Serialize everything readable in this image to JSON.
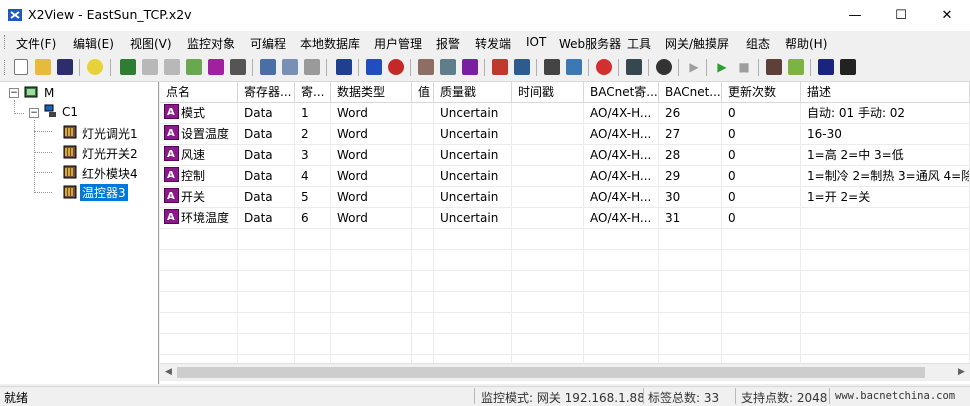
{
  "window": {
    "title": "X2View - EastSun_TCP.x2v",
    "minimize": "—",
    "maximize": "☐",
    "close": "✕"
  },
  "menu": [
    "文件(F)",
    "编辑(E)",
    "视图(V)",
    "监控对象",
    "可编程",
    "本地数据库",
    "用户管理",
    "报警",
    "转发端",
    "IOT",
    "Web服务器",
    "工具",
    "网关/触摸屏",
    "组态",
    "帮助(H)"
  ],
  "toolbar_icons": [
    "new-file-icon",
    "open-folder-icon",
    "save-icon",
    "help-icon",
    "add-device-icon",
    "edit-icon",
    "delete-icon",
    "import-icon",
    "csv-icon",
    "property-icon",
    "cut-icon",
    "copy-icon",
    "paste-icon",
    "monitor-icon",
    "list-icon",
    "clock-icon",
    "trend-icon",
    "history-icon",
    "b-icon",
    "chart-icon",
    "report-icon",
    "script-icon",
    "tool-icon",
    "alarm-icon",
    "log-icon",
    "view-icon",
    "play-icon",
    "run-icon",
    "stop-icon",
    "settings-icon",
    "download-icon",
    "device-icon",
    "home-icon"
  ],
  "tree": {
    "root": "M",
    "channel": "C1",
    "devices": [
      "灯光调光1",
      "灯光开关2",
      "红外模块4",
      "温控器3"
    ],
    "selected": "温控器3"
  },
  "columns": [
    "点名",
    "寄存器...",
    "寄...",
    "数据类型",
    "值",
    "质量戳",
    "时间戳",
    "BACnet寄...",
    "BACnet...",
    "更新次数",
    "描述"
  ],
  "rows": [
    [
      "模式",
      "Data",
      "1",
      "Word",
      "",
      "Uncertain",
      "",
      "AO/4X-H...",
      "26",
      "0",
      "自动: 01 手动: 02"
    ],
    [
      "设置温度",
      "Data",
      "2",
      "Word",
      "",
      "Uncertain",
      "",
      "AO/4X-H...",
      "27",
      "0",
      "16-30"
    ],
    [
      "风速",
      "Data",
      "3",
      "Word",
      "",
      "Uncertain",
      "",
      "AO/4X-H...",
      "28",
      "0",
      "1=高 2=中 3=低"
    ],
    [
      "控制",
      "Data",
      "4",
      "Word",
      "",
      "Uncertain",
      "",
      "AO/4X-H...",
      "29",
      "0",
      "1=制冷 2=制热 3=通风 4=除"
    ],
    [
      "开关",
      "Data",
      "5",
      "Word",
      "",
      "Uncertain",
      "",
      "AO/4X-H...",
      "30",
      "0",
      "1=开 2=关"
    ],
    [
      "环境温度",
      "Data",
      "6",
      "Word",
      "",
      "Uncertain",
      "",
      "AO/4X-H...",
      "31",
      "0",
      ""
    ]
  ],
  "status": {
    "ready": "就绪",
    "mode": "监控模式: 网关 192.168.1.88",
    "tag_total": "标签总数: 33",
    "support": "支持点数: 2048",
    "site": "www.bacnetchina.com"
  },
  "colors": {
    "selection": "#0078d7",
    "point_icon": "#8a1a8a"
  }
}
